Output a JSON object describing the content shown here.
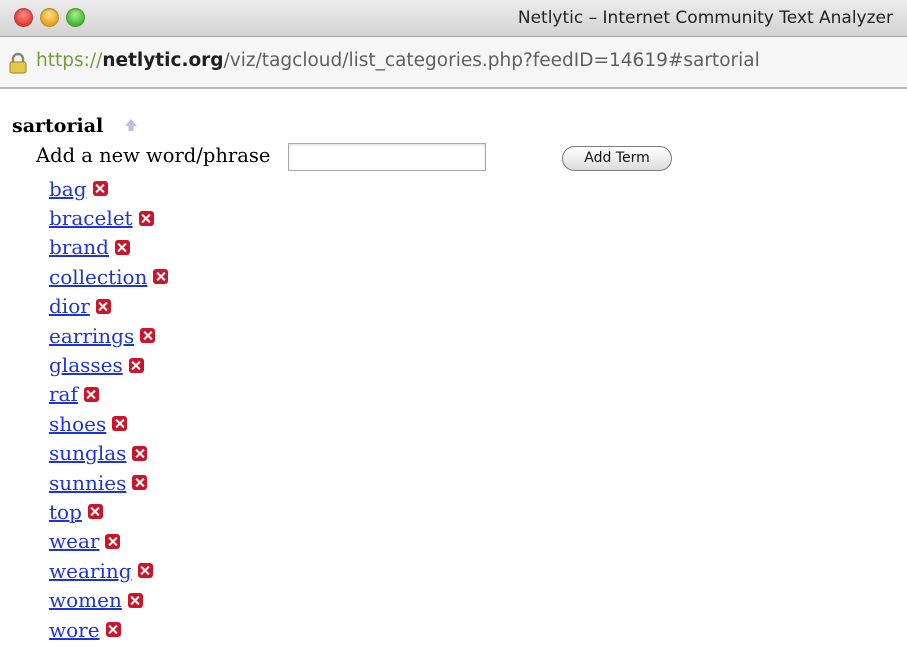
{
  "window": {
    "title": "Netlytic – Internet Community Text Analyzer"
  },
  "address": {
    "scheme": "https://",
    "host": "netlytic.org",
    "path": "/viz/tagcloud/list_categories.php?feedID=14619#sartorial"
  },
  "category": {
    "name": "sartorial"
  },
  "form": {
    "label": "Add a new word/phrase",
    "input_value": "",
    "button_label": "Add Term"
  },
  "terms": [
    "bag",
    "bracelet",
    "brand",
    "collection",
    "dior",
    "earrings",
    "glasses",
    "raf",
    "shoes",
    "sunglas",
    "sunnies",
    "top",
    "wear",
    "wearing",
    "women",
    "wore"
  ],
  "icons": {
    "lock": "lock-icon",
    "collapse": "arrow-up-icon",
    "remove": "remove-icon"
  },
  "colors": {
    "link": "#1f34d6",
    "remove": "#c8172a",
    "scheme": "#6f9f3f"
  }
}
